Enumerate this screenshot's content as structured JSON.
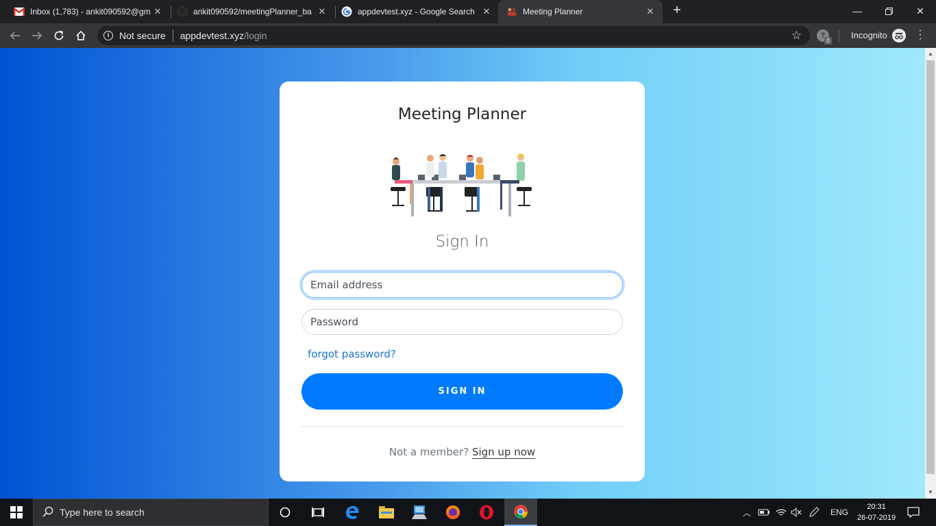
{
  "browser": {
    "tabs": [
      {
        "title": "Inbox (1,783) - ankit090592@gm",
        "icon": "gmail-icon"
      },
      {
        "title": "ankit090592/meetingPlanner_ba",
        "icon": "github-icon"
      },
      {
        "title": "appdevtest.xyz - Google Search",
        "icon": "google-icon"
      },
      {
        "title": "Meeting Planner",
        "icon": "meeting-favicon-icon",
        "active": true
      }
    ],
    "security_label": "Not secure",
    "url_host": "appdevtest.xyz",
    "url_path": "/login",
    "extension_badge": "0",
    "incognito_label": "Incognito"
  },
  "page": {
    "app_title": "Meeting Planner",
    "signin_heading": "Sign In",
    "email_placeholder": "Email address",
    "password_placeholder": "Password",
    "forgot_password": "forgot password?",
    "signin_button": "SIGN IN",
    "not_member": "Not a member?",
    "signup_link": "Sign up now"
  },
  "taskbar": {
    "search_placeholder": "Type here to search",
    "language": "ENG",
    "time": "20:31",
    "date": "26-07-2019"
  },
  "colors": {
    "accent": "#007bff",
    "link": "#1a73d9",
    "gradient_start": "#0052d4",
    "gradient_end": "#9fe9fb"
  }
}
